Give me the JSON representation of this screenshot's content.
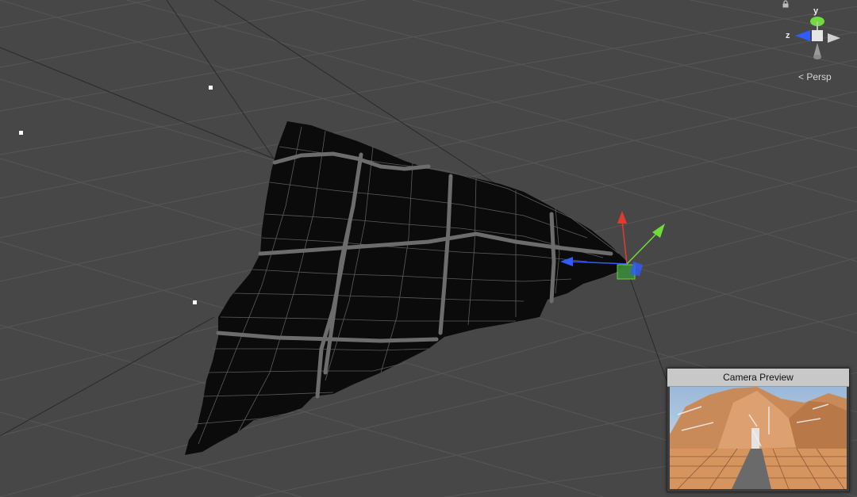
{
  "scene": {
    "background_color": "#474747",
    "grid_color": "#5a5a5a",
    "mesh_color": "#0b0b0b",
    "mesh_line_color": "#6e6e6e"
  },
  "gizmo": {
    "y_label": "y",
    "z_label": "z",
    "persp_label": "Persp",
    "y_color": "#6fdc3a",
    "z_color": "#2f5bff",
    "x_color": "#e23b2e",
    "icons": [
      "lock-icon",
      "camera-icon",
      "chevron-left-icon"
    ]
  },
  "transform_handle": {
    "x_color": "#e23b2e",
    "y_color": "#6fdc3a",
    "z_color": "#2f5bff"
  },
  "camera_preview": {
    "title": "Camera Preview"
  }
}
